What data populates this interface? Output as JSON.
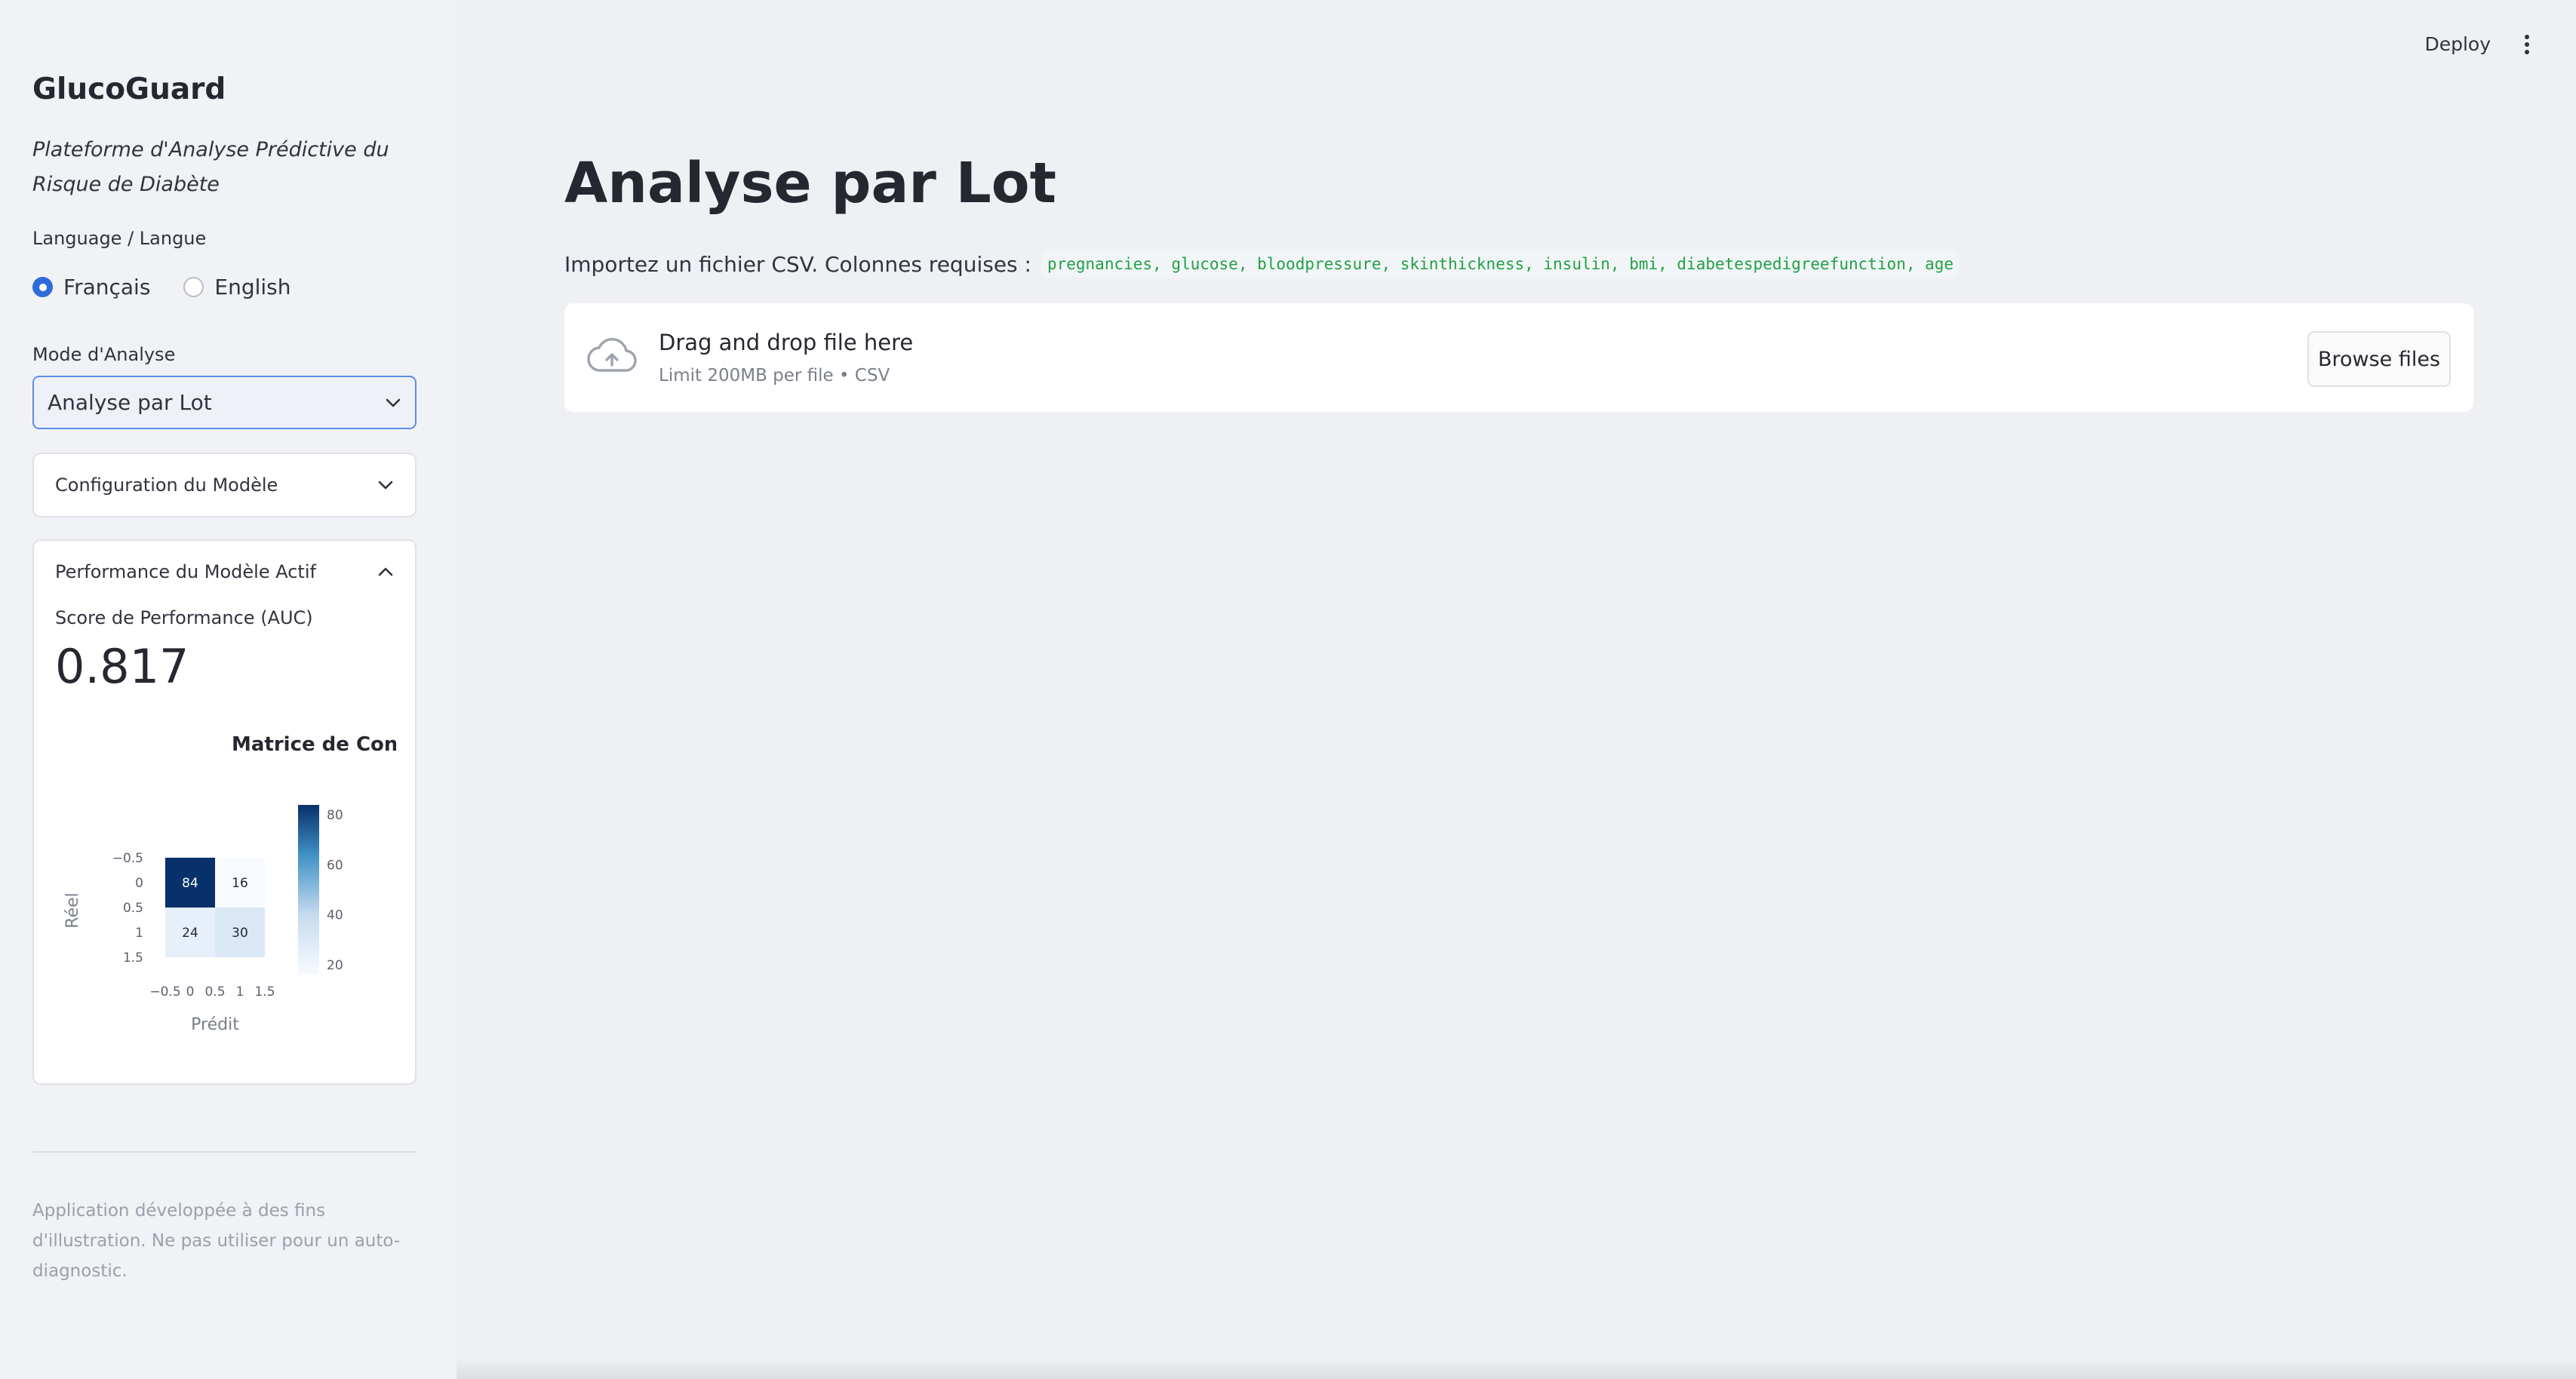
{
  "sidebar": {
    "app_title": "GlucoGuard",
    "app_subtitle": "Plateforme d'Analyse Prédictive du Risque de Diabète",
    "language_label": "Language / Langue",
    "language_options": [
      "Français",
      "English"
    ],
    "language_selected": "Français",
    "mode_label": "Mode d'Analyse",
    "mode_value": "Analyse par Lot",
    "config_expander_label": "Configuration du Modèle",
    "perf_expander_label": "Performance du Modèle Actif",
    "metric_label": "Score de Performance (AUC)",
    "metric_value": "0.817",
    "footer_note": "Application développée à des fins d'illustration. Ne pas utiliser pour un auto-diagnostic."
  },
  "header": {
    "deploy_label": "Deploy"
  },
  "main": {
    "title": "Analyse par Lot",
    "columns_prefix": "Importez un fichier CSV. Colonnes requises :",
    "columns_code": "pregnancies, glucose, bloodpressure, skinthickness, insulin, bmi, diabetespedigreefunction, age",
    "uploader": {
      "drop_text": "Drag and drop file here",
      "limit_text": "Limit 200MB per file • CSV",
      "browse_label": "Browse files"
    }
  },
  "chart_data": {
    "type": "heatmap",
    "title": "Matrice de Confus",
    "xlabel": "Prédit",
    "ylabel": "Réel",
    "x_ticks": [
      "−0.5",
      "0",
      "0.5",
      "1",
      "1.5"
    ],
    "y_ticks": [
      "−0.5",
      "0",
      "0.5",
      "1",
      "1.5"
    ],
    "matrix": [
      [
        84,
        16
      ],
      [
        24,
        30
      ]
    ],
    "colorbar_ticks": [
      "80",
      "60",
      "40",
      "20"
    ],
    "colorbar_range": [
      16,
      84
    ],
    "colormap": [
      "#f7fbff",
      "#08306b"
    ]
  }
}
